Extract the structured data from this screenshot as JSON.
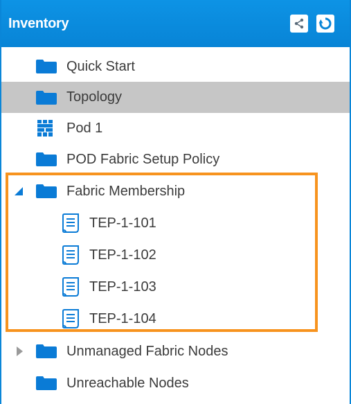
{
  "header": {
    "title": "Inventory",
    "share_icon": "share-network-icon",
    "refresh_icon": "refresh-icon"
  },
  "tree": {
    "items": [
      {
        "label": "Quick Start",
        "icon": "folder-icon"
      },
      {
        "label": "Topology",
        "icon": "folder-icon",
        "selected": true
      },
      {
        "label": "Pod 1",
        "icon": "pod-grid-icon"
      },
      {
        "label": "POD Fabric Setup Policy",
        "icon": "folder-icon"
      },
      {
        "label": "Fabric Membership",
        "icon": "folder-icon",
        "expanded": true,
        "children": [
          {
            "label": "TEP-1-101",
            "icon": "document-icon"
          },
          {
            "label": "TEP-1-102",
            "icon": "document-icon"
          },
          {
            "label": "TEP-1-103",
            "icon": "document-icon"
          },
          {
            "label": "TEP-1-104",
            "icon": "document-icon"
          }
        ]
      },
      {
        "label": "Unmanaged Fabric Nodes",
        "icon": "folder-icon",
        "expanded": false
      },
      {
        "label": "Unreachable Nodes",
        "icon": "folder-icon"
      }
    ]
  },
  "colors": {
    "header_bg": "#0a86d8",
    "folder": "#0a7bd6",
    "selected_row": "#c6c6c6",
    "highlight_border": "#f7931e",
    "text": "#3b3b3b"
  }
}
